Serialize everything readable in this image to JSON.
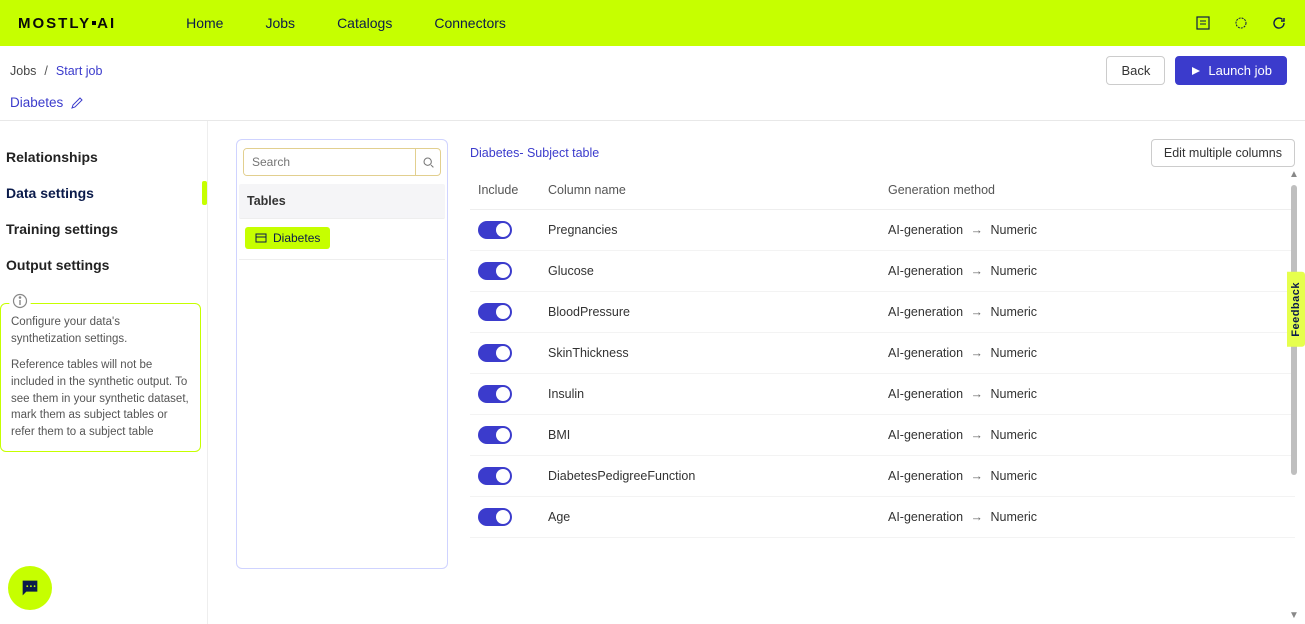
{
  "brand": "MOSTLY AI",
  "nav": {
    "home": "Home",
    "jobs": "Jobs",
    "catalogs": "Catalogs",
    "connectors": "Connectors"
  },
  "breadcrumb": {
    "root": "Jobs",
    "current": "Start job"
  },
  "buttons": {
    "back": "Back",
    "launch": "Launch job",
    "edit_multi": "Edit multiple columns"
  },
  "job": {
    "name": "Diabetes"
  },
  "sidebar": {
    "items": [
      {
        "label": "Relationships"
      },
      {
        "label": "Data settings"
      },
      {
        "label": "Training settings"
      },
      {
        "label": "Output settings"
      }
    ],
    "active_index": 1,
    "info_p1": "Configure your data's synthetization settings.",
    "info_p2": "Reference tables will not be included in the synthetic output. To see them in your synthetic dataset, mark them as subject tables or refer them to a subject table"
  },
  "tables_panel": {
    "search_placeholder": "Search",
    "heading": "Tables",
    "items": [
      {
        "label": "Diabetes"
      }
    ]
  },
  "columns": {
    "title": "Diabetes- Subject table",
    "headers": {
      "include": "Include",
      "name": "Column name",
      "method": "Generation method"
    },
    "rows": [
      {
        "name": "Pregnancies",
        "method_a": "AI-generation",
        "method_b": "Numeric"
      },
      {
        "name": "Glucose",
        "method_a": "AI-generation",
        "method_b": "Numeric"
      },
      {
        "name": "BloodPressure",
        "method_a": "AI-generation",
        "method_b": "Numeric"
      },
      {
        "name": "SkinThickness",
        "method_a": "AI-generation",
        "method_b": "Numeric"
      },
      {
        "name": "Insulin",
        "method_a": "AI-generation",
        "method_b": "Numeric"
      },
      {
        "name": "BMI",
        "method_a": "AI-generation",
        "method_b": "Numeric"
      },
      {
        "name": "DiabetesPedigreeFunction",
        "method_a": "AI-generation",
        "method_b": "Numeric"
      },
      {
        "name": "Age",
        "method_a": "AI-generation",
        "method_b": "Numeric"
      }
    ]
  },
  "feedback": "Feedback"
}
